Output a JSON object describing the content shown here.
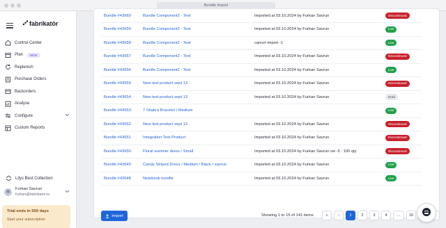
{
  "window": {
    "title": "Bundle Import"
  },
  "brand": {
    "name": "fabrikatör"
  },
  "sidebar": {
    "items": [
      {
        "label": "Control Center",
        "icon": "home-icon"
      },
      {
        "label": "Plan",
        "icon": "plan-icon",
        "badge": "NEW"
      },
      {
        "label": "Replenish",
        "icon": "refresh-icon"
      },
      {
        "label": "Purchase Orders",
        "icon": "purchase-orders-icon"
      },
      {
        "label": "Backorders",
        "icon": "backorders-icon"
      },
      {
        "label": "Analyse",
        "icon": "analyse-icon"
      },
      {
        "label": "Configure",
        "icon": "configure-icon",
        "chevron": true
      },
      {
        "label": "Custom Reports",
        "icon": "reports-icon"
      }
    ],
    "store": {
      "label": "Lilys Best Collection"
    },
    "user": {
      "name": "Furkan Savrun",
      "email": "furkan@fabrikator.io"
    },
    "trial": {
      "title": "Trial ends in 550 days",
      "subtitle": "Start your subscription"
    }
  },
  "table": {
    "rows": [
      {
        "bundle": "Bundle #43660",
        "product": "Bundle Component2 - Test",
        "note": "Imported at 03.10.2024 by Furkan Savrun",
        "status": "Discontinued"
      },
      {
        "bundle": "Bundle #43659",
        "product": "Bundle Component2 - Test",
        "note": "Imported at 03.10.2024 by Furkan Savrun",
        "status": "Live"
      },
      {
        "bundle": "Bundle #43658",
        "product": "Bundle Component2 - Test",
        "note": "cancel import -1",
        "status": "Live"
      },
      {
        "bundle": "Bundle #43657",
        "product": "Bundle Component2 - Test",
        "note": "Imported at 03.10.2024 by Furkan Savrun",
        "status": "Discontinued"
      },
      {
        "bundle": "Bundle #43656",
        "product": "Bundle Component2 - Test",
        "note": "Imported at 03.10.2024 by Furkan Savrun",
        "status": "Live"
      },
      {
        "bundle": "Bundle #43655",
        "product": "New test product sept 13",
        "note": "Imported at 03.10.2024 by Furkan Savrun",
        "status": "Discontinued"
      },
      {
        "bundle": "Bundle #43654",
        "product": "New test product sept 13",
        "note": "Imported at 03.10.2024 by Furkan Savrun",
        "status": "Draft"
      },
      {
        "bundle": "Bundle #43653",
        "product": "7 Shakra Bracelet / Medium",
        "note": "",
        "status": "Live"
      },
      {
        "bundle": "Bundle #43652",
        "product": "New test product sept 13",
        "note": "Imported at 03.10.2024 by Furkan Savrun",
        "status": "Discontinued"
      },
      {
        "bundle": "Bundle #43651",
        "product": "Integration Test Product",
        "note": "Imported at 03.10.2024 by Furkan Savrun",
        "status": "Discontinued"
      },
      {
        "bundle": "Bundle #43650",
        "product": "Floral summer dress / Small",
        "note": "Imported at 03.10.2024 by Furkan Savrun sw -5 : 100 qty",
        "status": "Discontinued"
      },
      {
        "bundle": "Bundle #43649",
        "product": "Candy Striped Dress / Medium / Black / savrun",
        "note": "Imported at 03.10.2024 by Furkan Savrun",
        "status": "Live"
      },
      {
        "bundle": "Bundle #43648",
        "product": "Notebook bundle",
        "note": "Imported at 03.10.2024 by Furkan Savrun",
        "status": "Live"
      }
    ]
  },
  "footer": {
    "import_label": "Import",
    "showing": "Showing 1 to 15 of 141 items",
    "pages": [
      "«",
      "‹",
      "1",
      "2",
      "3",
      "4",
      "...",
      "10",
      "›",
      "»"
    ],
    "current_page": "1"
  },
  "colors": {
    "accent": "#1f66d8",
    "discontinued": "#c8202b",
    "live": "#22a04a",
    "draft": "#e7e9ef",
    "trial_bg": "#fbe9cc"
  }
}
